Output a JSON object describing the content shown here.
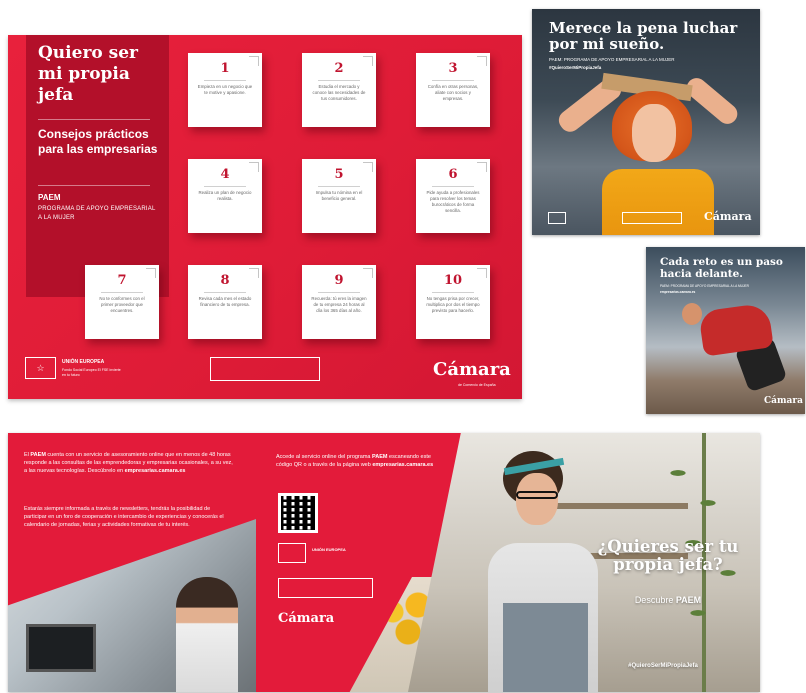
{
  "poster": {
    "title": "Quiero ser mi propia jefa",
    "subtitle": "Consejos prácticos para las empresarias",
    "paem": "PAEM",
    "program": "PROGRAMA DE APOYO EMPRESARIAL A LA MUJER",
    "cards": [
      {
        "num": "1",
        "text": "Empieza en un negocio que te motive y apasione."
      },
      {
        "num": "2",
        "text": "Estudia el mercado y conoce las necesidades de tus consumidores."
      },
      {
        "num": "3",
        "text": "Confía en otras personas, aliate con socios y empresas."
      },
      {
        "num": "4",
        "text": "Realiza un plan de negocio realista."
      },
      {
        "num": "5",
        "text": "Impulsa tu nómina en el beneficio general."
      },
      {
        "num": "6",
        "text": "Pide ayuda a profesionales para resolver los temas burocráticos de forma sencilla."
      },
      {
        "num": "7",
        "text": "No te conformes con el primer proveedor que encuentres."
      },
      {
        "num": "8",
        "text": "Revisa cada mes el estado financiero de tu empresa."
      },
      {
        "num": "9",
        "text": "Recuerda: tú eres la imagen de tu empresa 24 horas al día los 365 días al año."
      },
      {
        "num": "10",
        "text": "No tengas prisa por crecer, multiplica por dos el tiempo previsto para hacerlo."
      }
    ],
    "eu_label": "UNIÓN EUROPEA",
    "eu_small": "Fondo Social Europeo El FSE invierte en tu futuro",
    "logo": "Cámara",
    "logo_sub": "de Comercio de España"
  },
  "ad1": {
    "headline": "Merece la pena luchar por mi sueño.",
    "sub": "PAEM: PROGRAMA DE APOYO EMPRESARIAL A LA MUJER",
    "hashtag": "#QuieroSerMiPropiaJefa",
    "logo": "Cámara"
  },
  "ad2": {
    "headline": "Cada reto es un paso hacia delante.",
    "sub": "PAEM: PROGRAMA DE APOYO EMPRESARIAL A LA MUJER",
    "hashtag": "empresarias.camara.es",
    "logo": "Cámara"
  },
  "brochure": {
    "para1_a": "El ",
    "para1_b": "PAEM",
    "para1_c": " cuenta con un servicio de asesoramiento online que en menos de 48 horas responde a las consultas de las emprendedoras y empresarias ocasionales, a su vez, a las nuevas tecnologías. Descúbrelo en ",
    "para1_d": "empresarias.camara.es",
    "para2": "Estarás siempre informada a través de newsletters, tendrás la posibilidad de participar en un foro de cooperación e intercambio de experiencias y conocerás el calendario de jornadas, ferias y actividades formativas de tu interés.",
    "col2_a": "Accede al servicio online del programa ",
    "col2_b": "PAEM",
    "col2_c": " escaneando este código QR o a través de la página web ",
    "col2_d": "empresarias.camara.es",
    "eu_label": "UNIÓN EUROPEA",
    "logo": "Cámara",
    "cover_title": "¿Quieres ser tu propia jefa?",
    "cover_sub_a": "Descubre ",
    "cover_sub_b": "PAEM",
    "hashtag": "#QuieroSerMiPropiaJefa"
  },
  "colors": {
    "brand_red": "#e31b3a",
    "dark_red": "#b3102a"
  }
}
